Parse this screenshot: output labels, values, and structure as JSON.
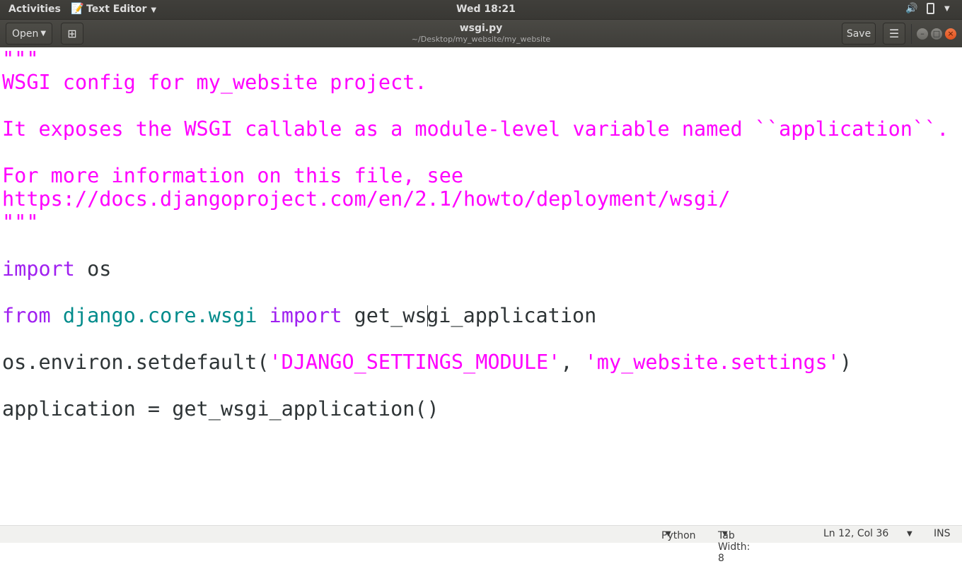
{
  "topbar": {
    "activities": "Activities",
    "app_name": "Text Editor",
    "clock": "Wed 18:21",
    "app_icon": "text-editor-icon",
    "volume_icon": "volume-icon",
    "battery_icon": "battery-icon"
  },
  "header": {
    "open_label": "Open",
    "title": "wsgi.py",
    "subtitle": "~/Desktop/my_website/my_website",
    "save_label": "Save",
    "new_tab_icon": "new-document-icon",
    "menu_icon": "hamburger-menu-icon"
  },
  "editor": {
    "cursor": {
      "line": 12,
      "col": 36
    },
    "lines": [
      [
        [
          "str",
          "\"\"\""
        ]
      ],
      [
        [
          "str",
          "WSGI config for my_website project."
        ]
      ],
      [],
      [
        [
          "str",
          "It exposes the WSGI callable as a module-level variable named ``application``."
        ]
      ],
      [],
      [
        [
          "str",
          "For more information on this file, see"
        ]
      ],
      [
        [
          "str",
          "https://docs.djangoproject.com/en/2.1/howto/deployment/wsgi/"
        ]
      ],
      [
        [
          "str",
          "\"\"\""
        ]
      ],
      [],
      [
        [
          "kw",
          "import"
        ],
        [
          "plain",
          " os"
        ]
      ],
      [],
      [
        [
          "kw",
          "from"
        ],
        [
          "plain",
          " "
        ],
        [
          "mod",
          "django.core.wsgi"
        ],
        [
          "plain",
          " "
        ],
        [
          "kw",
          "import"
        ],
        [
          "plain",
          " get_ws"
        ],
        [
          "cursor",
          ""
        ],
        [
          "plain",
          "gi_application"
        ]
      ],
      [],
      [
        [
          "plain",
          "os.environ.setdefault("
        ],
        [
          "str",
          "'DJANGO_SETTINGS_MODULE'"
        ],
        [
          "plain",
          ", "
        ],
        [
          "str",
          "'my_website.settings'"
        ],
        [
          "plain",
          ")"
        ]
      ],
      [],
      [
        [
          "plain",
          "application = get_wsgi_application()"
        ]
      ]
    ]
  },
  "statusbar": {
    "language": "Python",
    "tab_width": "Tab Width: 8",
    "position": "Ln 12, Col 36",
    "mode": "INS"
  },
  "colors": {
    "string": "#ff00ff",
    "keyword": "#a020f0",
    "module": "#008b8b",
    "text": "#2e3436"
  }
}
